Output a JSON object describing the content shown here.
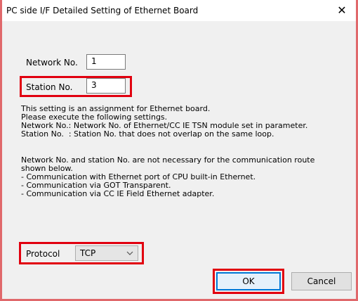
{
  "window": {
    "title": "PC side I/F Detailed Setting of Ethernet Board",
    "close_glyph": "✕"
  },
  "network": {
    "label": "Network No.",
    "value": "1"
  },
  "station": {
    "label": "Station No.",
    "value": "3"
  },
  "description": {
    "line1": "This setting is an assignment for Ethernet board.",
    "line2": "Please execute the following settings.",
    "line3": "Network No.: Network No. of Ethernet/CC IE TSN module set in parameter.",
    "line4": "Station No.  : Station No. that does not overlap on the same loop.",
    "line5": "Network No. and station No. are not necessary for the communication route",
    "line6": "shown below.",
    "line7": "- Communication with Ethernet port of CPU built-in Ethernet.",
    "line8": "- Communication via GOT Transparent.",
    "line9": "- Communication via CC IE Field Ethernet adapter."
  },
  "protocol": {
    "label": "Protocol",
    "selected": "TCP",
    "arrow_icon": "chevron-down-icon"
  },
  "buttons": {
    "ok": "OK",
    "cancel": "Cancel"
  },
  "colors": {
    "highlight_box": "#e1000f",
    "window_border": "#e0686b",
    "default_button_border": "#0078d7"
  }
}
